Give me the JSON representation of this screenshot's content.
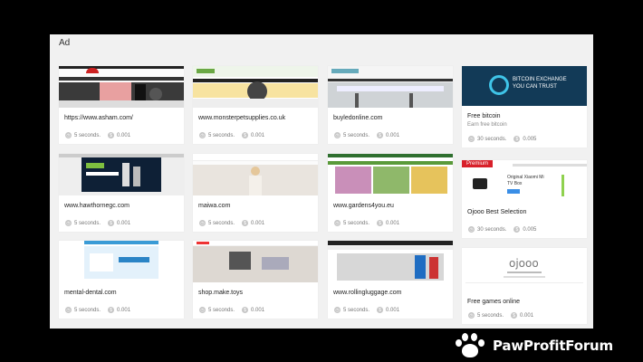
{
  "panel": {
    "title": "Ad"
  },
  "cards": [
    {
      "title": "https://www.asham.com/",
      "time": "5 seconds.",
      "price": "0.001"
    },
    {
      "title": "www.monsterpetsupplies.co.uk",
      "time": "5 seconds.",
      "price": "0.001"
    },
    {
      "title": "buyledonline.com",
      "time": "5 seconds.",
      "price": "0.001"
    },
    {
      "title": "Free bitcoin",
      "subtitle": "Earn free bitcoin",
      "time": "30 seconds.",
      "price": "0.005",
      "thumb_text": [
        "BITCOIN EXCHANGE",
        "YOU CAN TRUST"
      ]
    },
    {
      "title": "www.hawthornegc.com",
      "time": "5 seconds.",
      "price": "0.001"
    },
    {
      "title": "maiwa.com",
      "time": "5 seconds.",
      "price": "0.001"
    },
    {
      "title": "www.gardens4you.eu",
      "time": "5 seconds.",
      "price": "0.001"
    },
    {
      "title": "Ojooo Best Selection",
      "time": "30 seconds.",
      "price": "0.005",
      "badge": "Premium",
      "thumb_text": [
        "Original Xiaomi Mi",
        "TV Box"
      ]
    },
    {
      "title": "mental-dental.com",
      "time": "5 seconds.",
      "price": "0.001"
    },
    {
      "title": "shop.make.toys",
      "time": "5 seconds.",
      "price": "0.001"
    },
    {
      "title": "www.rollingluggage.com",
      "time": "5 seconds.",
      "price": "0.001"
    },
    {
      "title": "Free games online",
      "time": "5 seconds.",
      "price": "0.001",
      "thumb_text": [
        "ojooo"
      ]
    }
  ],
  "brand": {
    "name": "PawProfitForum"
  },
  "colors": {
    "panel_bg": "#f1f1f1",
    "bitcoin_bg": "#123a57",
    "premium_red": "#d8202a",
    "watermark_bg": "#000000"
  },
  "icons": {
    "time": "clock-icon",
    "price": "dollar-coin-icon",
    "logo": "paw-icon"
  }
}
